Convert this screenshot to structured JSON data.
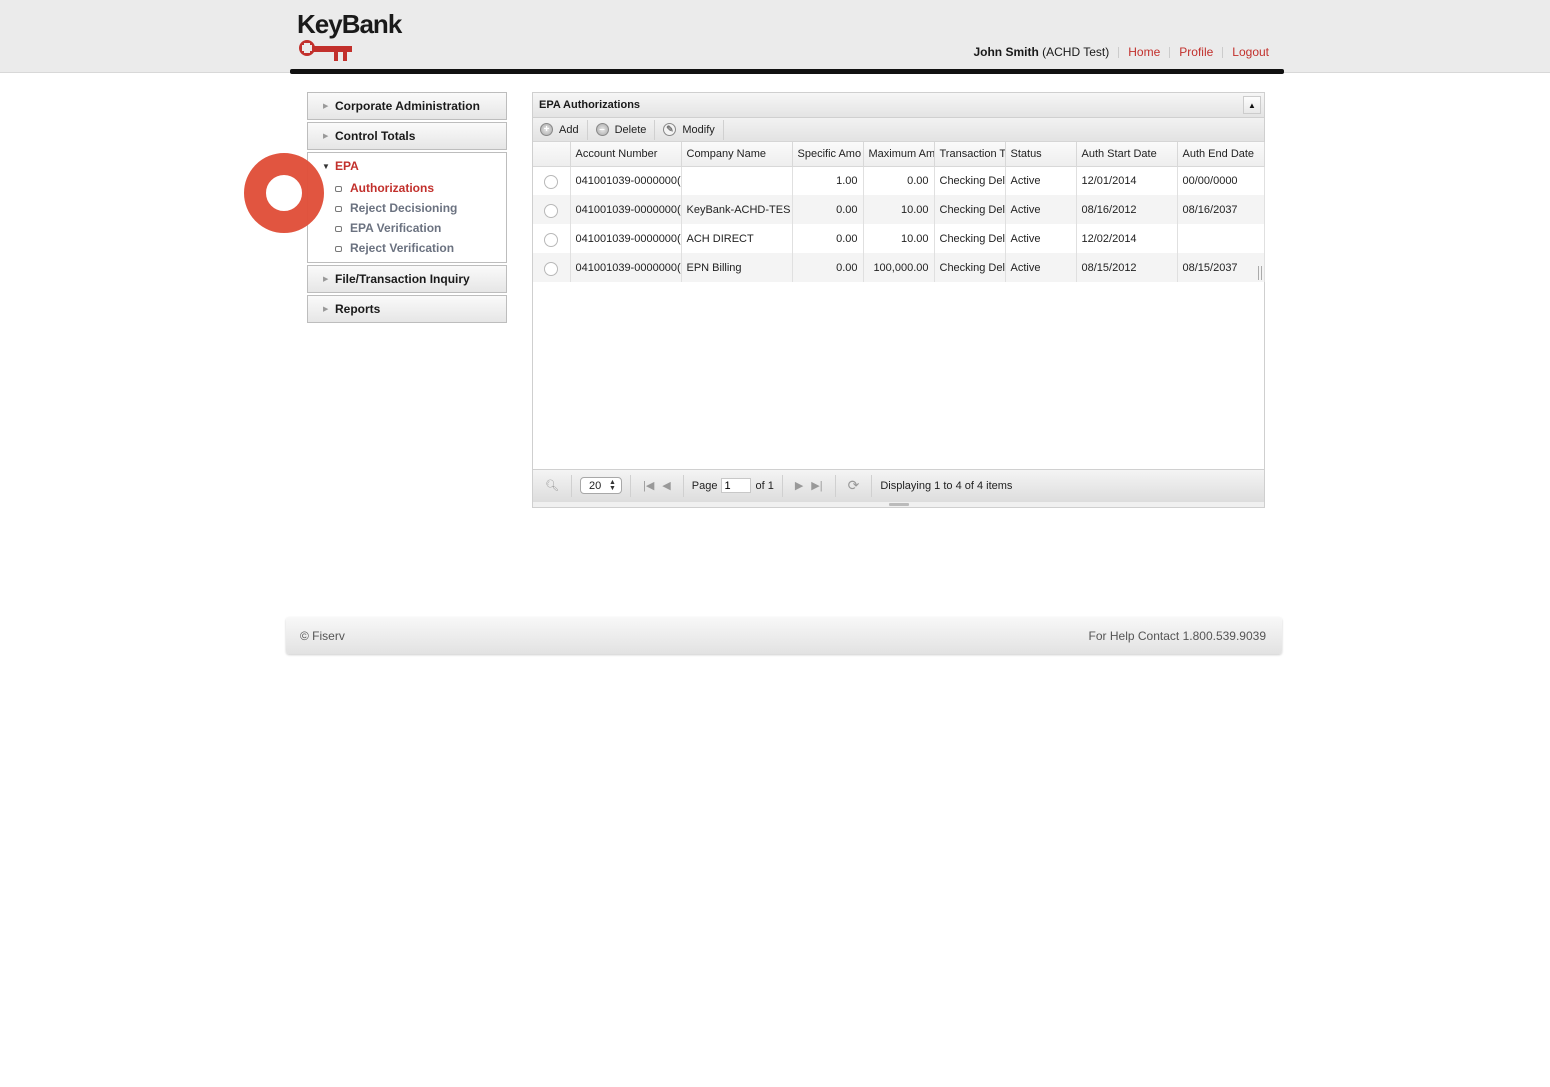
{
  "header": {
    "brand": "KeyBank",
    "user_name": "John Smith",
    "user_role": "(ACHD Test)",
    "links": [
      "Home",
      "Profile",
      "Logout"
    ],
    "accent_color": "#c2302c"
  },
  "sidebar": {
    "sections_before": [
      {
        "label": "Corporate Administration",
        "icon": "chevron-right-icon"
      },
      {
        "label": "Control Totals",
        "icon": "chevron-right-icon"
      }
    ],
    "open_section": {
      "label": "EPA",
      "icon": "chevron-down-icon",
      "items": [
        {
          "label": "Authorizations",
          "active": true
        },
        {
          "label": "Reject Decisioning",
          "active": false
        },
        {
          "label": "EPA Verification",
          "active": false
        },
        {
          "label": "Reject Verification",
          "active": false
        }
      ]
    },
    "sections_after": [
      {
        "label": "File/Transaction Inquiry",
        "icon": "chevron-right-icon"
      },
      {
        "label": "Reports",
        "icon": "chevron-right-icon"
      }
    ]
  },
  "highlight": {
    "color": "#e04f3a",
    "target": "Authorizations"
  },
  "grid": {
    "title": "EPA Authorizations",
    "toolbar": {
      "add": "Add",
      "delete": "Delete",
      "modify": "Modify"
    },
    "columns": [
      "Account Number",
      "Company Name",
      "Specific Amo",
      "Maximum Am",
      "Transaction T",
      "Status",
      "Auth Start Date",
      "Auth End Date"
    ],
    "rows": [
      [
        "041001039-0000000(",
        "",
        "1.00",
        "0.00",
        "Checking Del",
        "Active",
        "12/01/2014",
        "00/00/0000"
      ],
      [
        "041001039-0000000(",
        "KeyBank-ACHD-TES",
        "0.00",
        "10.00",
        "Checking Del",
        "Active",
        "08/16/2012",
        "08/16/2037"
      ],
      [
        "041001039-0000000(",
        "ACH DIRECT",
        "0.00",
        "10.00",
        "Checking Del",
        "Active",
        "12/02/2014",
        ""
      ],
      [
        "041001039-0000000(",
        "EPN Billing",
        "0.00",
        "100,000.00",
        "Checking Del",
        "Active",
        "08/15/2012",
        "08/15/2037"
      ]
    ],
    "pager": {
      "page_size": "20",
      "page_label": "Page",
      "page_value": "1",
      "of_label": "of 1",
      "status": "Displaying 1 to 4 of 4 items"
    }
  },
  "footer": {
    "copyright": "© Fiserv",
    "help": "For Help Contact 1.800.539.9039"
  }
}
